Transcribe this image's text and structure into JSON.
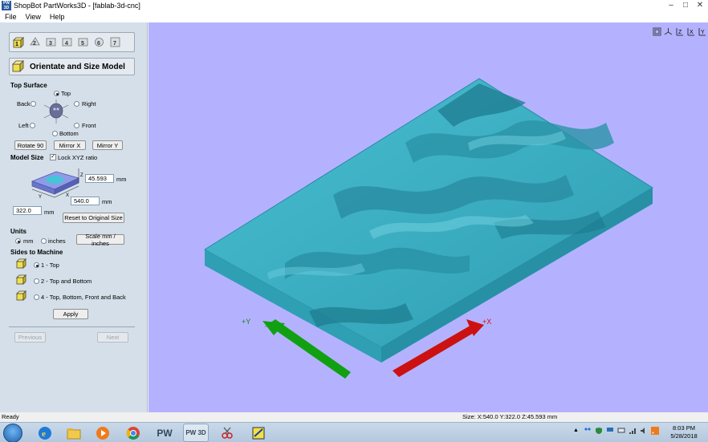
{
  "window": {
    "title": "ShopBot PartWorks3D - [fablab-3d-cnc]",
    "app_icon_text": "PW 3D",
    "controls": {
      "minimize": "–",
      "maximize": "□",
      "close": "✕"
    }
  },
  "menu": [
    {
      "label": "File"
    },
    {
      "label": "View"
    },
    {
      "label": "Help"
    }
  ],
  "steps": [
    "1",
    "2",
    "3",
    "4",
    "5",
    "6",
    "7"
  ],
  "panel": {
    "title": "Orientate and Size Model",
    "top_surface": {
      "heading": "Top Surface",
      "options": {
        "top": "Top",
        "back": "Back",
        "right": "Right",
        "left": "Left",
        "front": "Front",
        "bottom": "Bottom"
      },
      "selected": "top"
    },
    "buttons": {
      "rotate": "Rotate 90",
      "mirror_x": "Mirror X",
      "mirror_y": "Mirror Y",
      "reset": "Reset to Original Size",
      "scale": "Scale mm / inches",
      "apply": "Apply",
      "previous": "Previous",
      "next": "Next"
    },
    "model_size": {
      "heading": "Model Size",
      "lock_label": "Lock XYZ ratio",
      "lock_checked": true,
      "z_value": "45.593",
      "x_value": "540.0",
      "y_value": "322.0",
      "unit": "mm",
      "axis_x": "X",
      "axis_y": "Y",
      "axis_z": "Z"
    },
    "units": {
      "heading": "Units",
      "mm": "mm",
      "inches": "inches",
      "selected": "mm"
    },
    "sides": {
      "heading": "Sides to Machine",
      "options": [
        "1 - Top",
        "2 - Top and Bottom",
        "4 - Top, Bottom, Front and Back"
      ],
      "selected": 0
    }
  },
  "viewport": {
    "background": "#b4b2ff",
    "model_color": "#3aaec2",
    "x_arrow_color": "#cc1111",
    "y_arrow_color": "#11a011",
    "axis_labels": {
      "x": "+X",
      "y": "+Y"
    },
    "view_tools": [
      "fit-icon",
      "view-iso-icon",
      "view-z-icon",
      "view-x-icon",
      "view-y-icon"
    ]
  },
  "status": {
    "left": "Ready",
    "right": "Size: X:540.0 Y:322.0 Z:45.593 mm"
  },
  "taskbar": {
    "apps": [
      "ie-icon",
      "explorer-icon",
      "media-player-icon",
      "chrome-icon",
      "pw-icon",
      "pw3d-icon",
      "snipping-icon",
      "cut-icon"
    ],
    "pw_text": "PW",
    "pw3d_text": "PW 3D",
    "time": "8:03 PM",
    "date": "5/28/2018"
  }
}
